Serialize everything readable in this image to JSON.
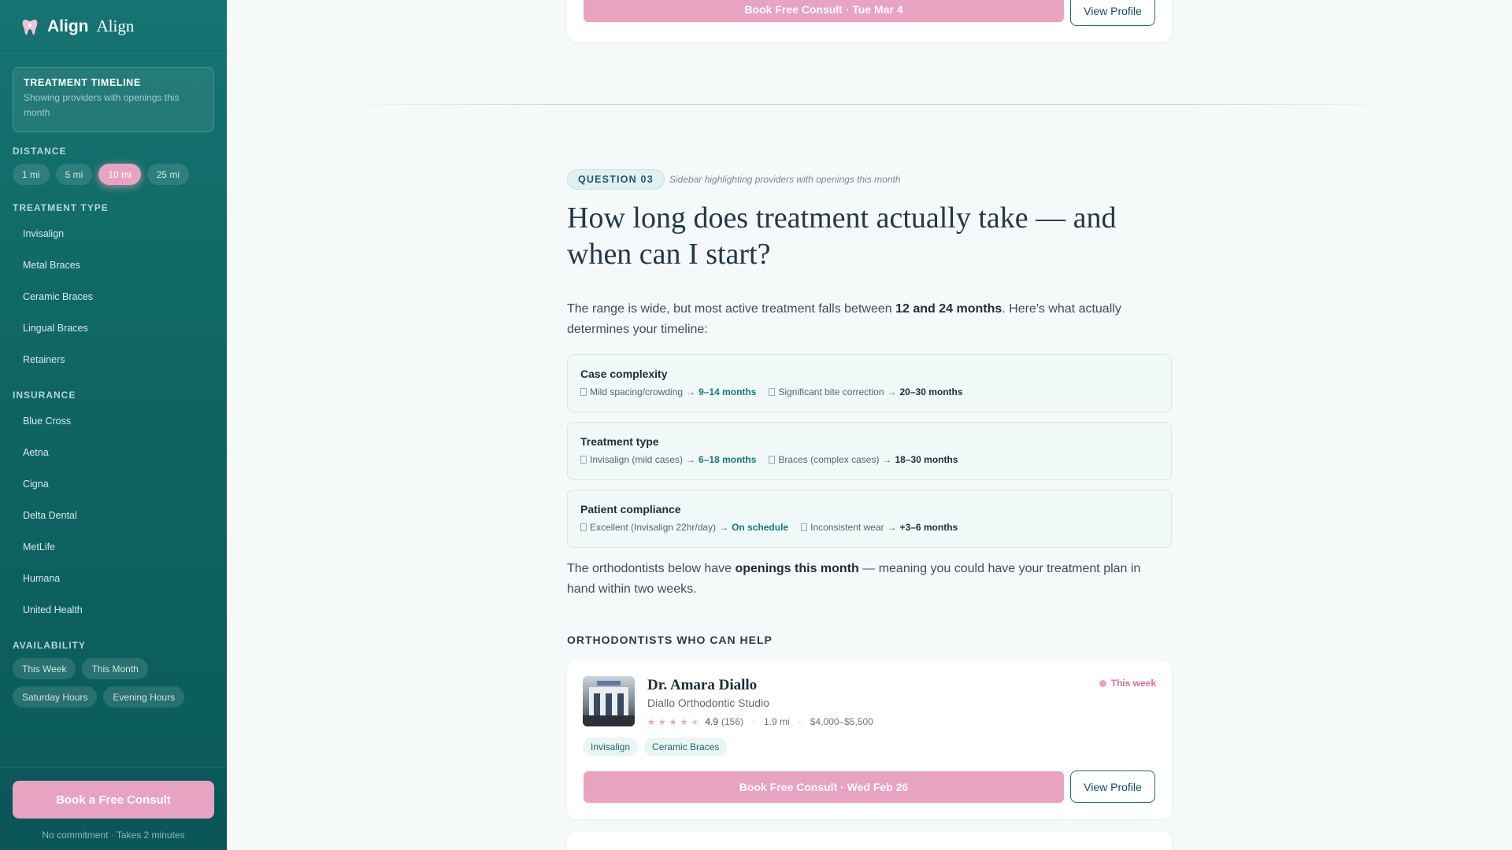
{
  "brand": {
    "name": "Align",
    "name_secondary": "Align"
  },
  "sidebar": {
    "timeline": {
      "title": "TREATMENT TIMELINE",
      "subtitle": "Showing providers with openings this month"
    },
    "distance": {
      "label": "DISTANCE",
      "options": [
        "1 mi",
        "5 mi",
        "10 mi",
        "25 mi"
      ],
      "selected": "10 mi"
    },
    "treatment_type": {
      "label": "TREATMENT TYPE",
      "items": [
        "Invisalign",
        "Metal Braces",
        "Ceramic Braces",
        "Lingual Braces",
        "Retainers"
      ]
    },
    "insurance": {
      "label": "INSURANCE",
      "items": [
        "Blue Cross",
        "Aetna",
        "Cigna",
        "Delta Dental",
        "MetLife",
        "Humana",
        "United Health"
      ]
    },
    "availability": {
      "label": "AVAILABILITY",
      "options": [
        "This Week",
        "This Month",
        "Saturday Hours",
        "Evening Hours"
      ]
    },
    "cta": {
      "label": "Book a Free Consult",
      "note": "No commitment · Takes 2 minutes"
    }
  },
  "top_card": {
    "book_label": "Book Free Consult · Tue Mar 4",
    "view_label": "View Profile"
  },
  "question": {
    "badge": "QUESTION 03",
    "note": "Sidebar highlighting providers with openings this month",
    "title": "How long does treatment actually take — and when can I start?",
    "intro_before": "The range is wide, but most active treatment falls between ",
    "intro_bold": "12 and 24 months",
    "intro_after": ". Here's what actually determines your timeline:",
    "factors": [
      {
        "title": "Case complexity",
        "options": [
          {
            "label": "Mild spacing/crowding",
            "value": "9–14 months",
            "style": "teal"
          },
          {
            "label": "Significant bite correction",
            "value": "20–30 months",
            "style": "dark"
          }
        ]
      },
      {
        "title": "Treatment type",
        "options": [
          {
            "label": "Invisalign (mild cases)",
            "value": "6–18 months",
            "style": "teal"
          },
          {
            "label": "Braces (complex cases)",
            "value": "18–30 months",
            "style": "dark"
          }
        ]
      },
      {
        "title": "Patient compliance",
        "options": [
          {
            "label": "Excellent (Invisalign 22hr/day)",
            "value": "On schedule",
            "style": "teal"
          },
          {
            "label": "Inconsistent wear",
            "value": "+3–6 months",
            "style": "dark"
          }
        ]
      }
    ],
    "outro_before": "The orthodontists below have ",
    "outro_bold": "openings this month",
    "outro_after": " — meaning you could have your treatment plan in hand within two weeks."
  },
  "help": {
    "label": "ORTHODONTISTS WHO CAN HELP",
    "providers": [
      {
        "name": "Dr. Amara Diallo",
        "practice": "Diallo Orthodontic Studio",
        "rating": "4.9",
        "reviews": "(156)",
        "distance": "1.9 mi",
        "price": "$4,000–$5,500",
        "availability": "This week",
        "tags": [
          "Invisalign",
          "Ceramic Braces"
        ],
        "book_label": "Book Free Consult · Wed Feb 26",
        "view_label": "View Profile"
      }
    ]
  },
  "colors": {
    "sidebar": "#0f6563",
    "accent_pink": "#e8a3c0",
    "teal_text": "#137a78"
  }
}
